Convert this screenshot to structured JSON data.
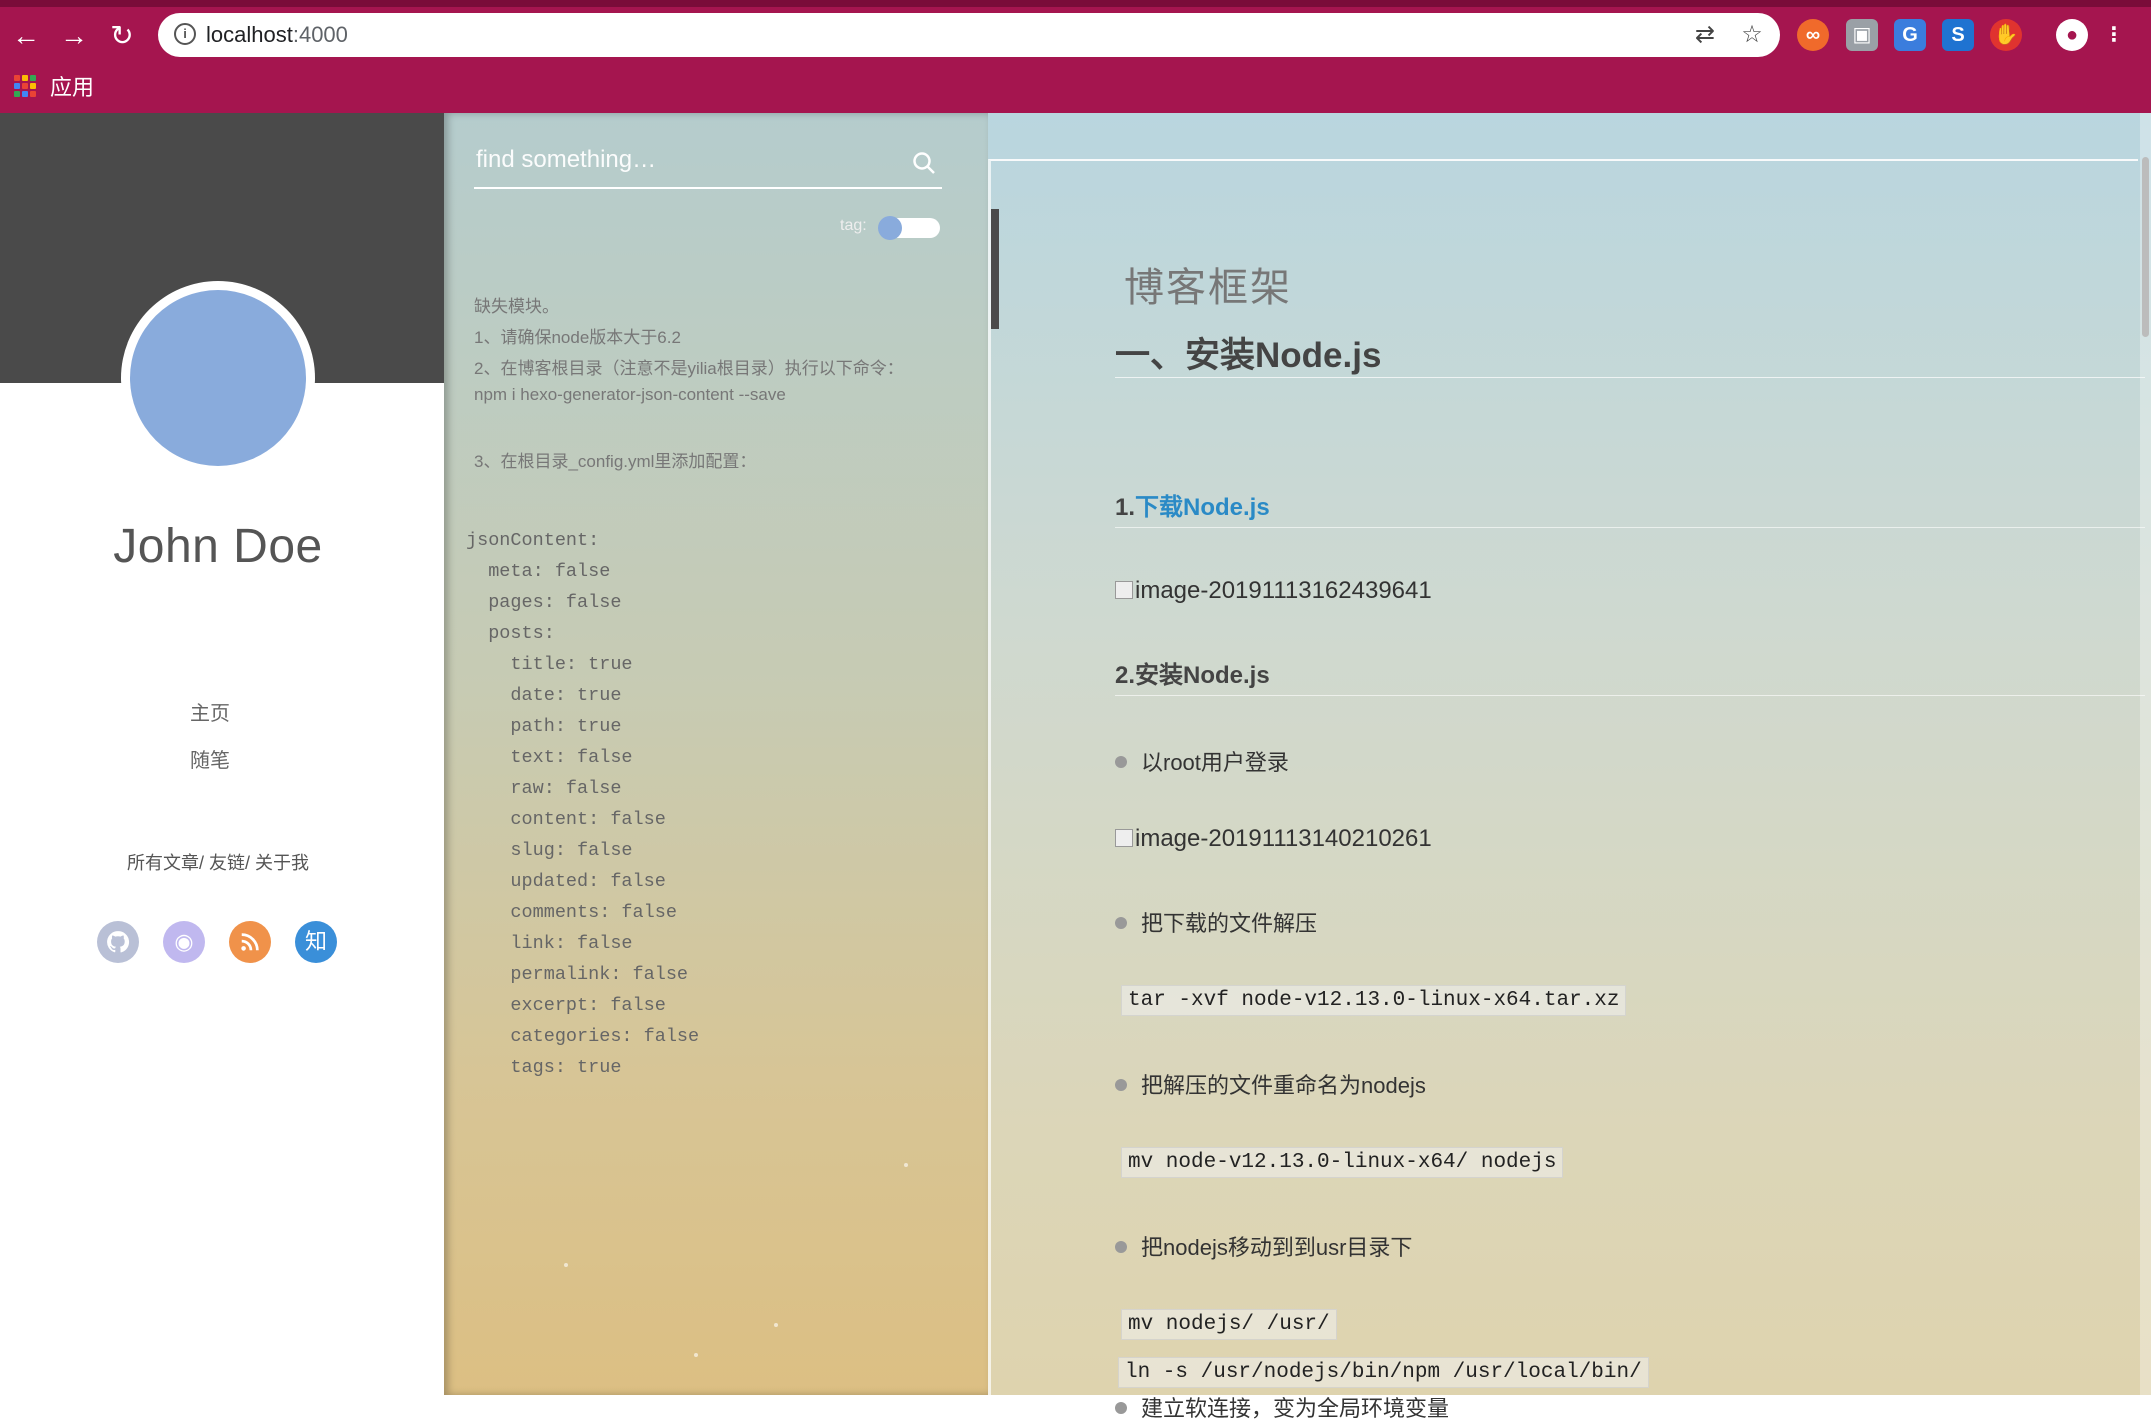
{
  "browser": {
    "url_host": "localhost",
    "url_port": ":4000",
    "bookmarks_apps_label": "应用",
    "colors": {
      "chrome": "#a5154f"
    }
  },
  "profile": {
    "name": "John Doe",
    "menu": [
      "主页",
      "随笔"
    ],
    "links": "所有文章/ 友链/ 关于我",
    "social": [
      {
        "icon": "github-icon",
        "color": "#b9c0d6"
      },
      {
        "icon": "weibo-icon",
        "color": "#c0b8ef"
      },
      {
        "icon": "rss-icon",
        "color": "#f0924a"
      },
      {
        "icon": "zhihu-icon",
        "label": "知",
        "color": "#3a8fd9"
      }
    ]
  },
  "search": {
    "placeholder": "find something…",
    "tag_label": "tag:"
  },
  "notice": {
    "line1": "缺失模块。",
    "line2": "1、请确保node版本大于6.2",
    "line3": "2、在博客根目录（注意不是yilia根目录）执行以下命令：",
    "line4": "npm i hexo-generator-json-content --save",
    "line5": "3、在根目录_config.yml里添加配置：",
    "json_config": "jsonContent:\n  meta: false\n  pages: false\n  posts:\n    title: true\n    date: true\n    path: true\n    text: false\n    raw: false\n    content: false\n    slug: false\n    updated: false\n    comments: false\n    link: false\n    permalink: false\n    excerpt: false\n    categories: false\n    tags: true"
  },
  "article": {
    "title": "博客框架",
    "h1": "一、安装Node.js",
    "h3_1_prefix": "1.",
    "h3_1_link": "下载Node.js",
    "img1": "image-20191113162439641",
    "h3_2": "2.安装Node.js",
    "bullet1": "以root用户登录",
    "img2": "image-20191113140210261",
    "bullet2": "把下载的文件解压",
    "code1": "tar -xvf node-v12.13.0-linux-x64.tar.xz",
    "bullet3": "把解压的文件重命名为nodejs",
    "code2": "mv node-v12.13.0-linux-x64/ nodejs",
    "bullet4": "把nodejs移动到到usr目录下",
    "code3": "mv nodejs/ /usr/",
    "bullet5": "建立软连接，变为全局环境变量",
    "code4": "ln -s /usr/nodejs/bin/npm /usr/local/bin/"
  }
}
